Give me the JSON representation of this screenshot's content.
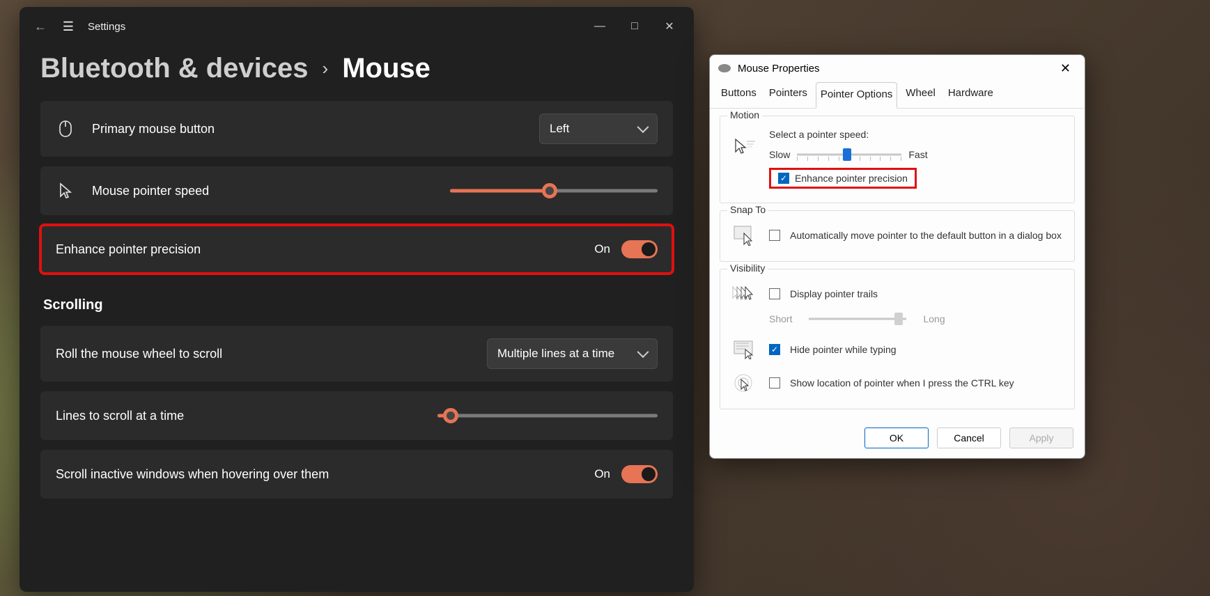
{
  "settings": {
    "app_title": "Settings",
    "breadcrumb_parent": "Bluetooth & devices",
    "breadcrumb_current": "Mouse",
    "primary_button": {
      "label": "Primary mouse button",
      "value": "Left"
    },
    "pointer_speed": {
      "label": "Mouse pointer speed",
      "value_pct": 48
    },
    "enhance_precision": {
      "label": "Enhance pointer precision",
      "state_text": "On"
    },
    "scrolling_header": "Scrolling",
    "wheel_scroll": {
      "label": "Roll the mouse wheel to scroll",
      "value": "Multiple lines at a time"
    },
    "lines_scroll": {
      "label": "Lines to scroll at a time",
      "value_pct": 6
    },
    "inactive_scroll": {
      "label": "Scroll inactive windows when hovering over them",
      "state_text": "On"
    }
  },
  "dialog": {
    "title": "Mouse Properties",
    "tabs": [
      "Buttons",
      "Pointers",
      "Pointer Options",
      "Wheel",
      "Hardware"
    ],
    "active_tab": 2,
    "motion": {
      "legend": "Motion",
      "speed_label": "Select a pointer speed:",
      "slow": "Slow",
      "fast": "Fast",
      "speed_pct": 48,
      "enhance_label": "Enhance pointer precision",
      "enhance_checked": true
    },
    "snap": {
      "legend": "Snap To",
      "label": "Automatically move pointer to the default button in a dialog box",
      "checked": false
    },
    "visibility": {
      "legend": "Visibility",
      "trails_label": "Display pointer trails",
      "trails_checked": false,
      "short": "Short",
      "long": "Long",
      "trails_pct": 92,
      "hide_label": "Hide pointer while typing",
      "hide_checked": true,
      "ctrl_label": "Show location of pointer when I press the CTRL key",
      "ctrl_checked": false
    },
    "buttons": {
      "ok": "OK",
      "cancel": "Cancel",
      "apply": "Apply"
    }
  }
}
